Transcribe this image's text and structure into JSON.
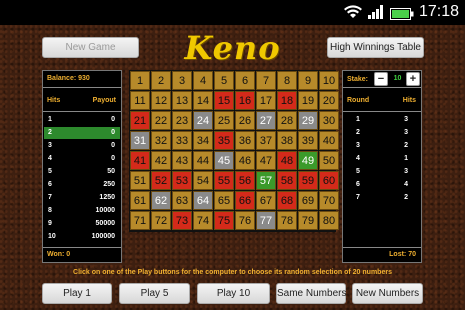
{
  "status_bar": {
    "time": "17:18",
    "icons": [
      "wifi-icon",
      "signal-icon",
      "battery-icon"
    ]
  },
  "app": {
    "title": "Keno",
    "new_game_label": "New Game",
    "high_winnings_label": "High Winnings Table"
  },
  "left_panel": {
    "balance_label": "Balance: 930",
    "hits_header": "Hits",
    "payout_header": "Payout",
    "rows": [
      {
        "hits": "1",
        "payout": "0",
        "highlight": false
      },
      {
        "hits": "2",
        "payout": "0",
        "highlight": true
      },
      {
        "hits": "3",
        "payout": "0",
        "highlight": false
      },
      {
        "hits": "4",
        "payout": "0",
        "highlight": false
      },
      {
        "hits": "5",
        "payout": "50",
        "highlight": false
      },
      {
        "hits": "6",
        "payout": "250",
        "highlight": false
      },
      {
        "hits": "7",
        "payout": "1250",
        "highlight": false
      },
      {
        "hits": "8",
        "payout": "10000",
        "highlight": false
      },
      {
        "hits": "9",
        "payout": "50000",
        "highlight": false
      },
      {
        "hits": "10",
        "payout": "100000",
        "highlight": false
      }
    ],
    "won_label": "Won: 0"
  },
  "right_panel": {
    "stake_label": "Stake:",
    "stake_value": "10",
    "minus_label": "−",
    "plus_label": "+",
    "round_header": "Round",
    "hits_header": "Hits",
    "rows": [
      {
        "round": "1",
        "hits": "3"
      },
      {
        "round": "2",
        "hits": "3"
      },
      {
        "round": "3",
        "hits": "2"
      },
      {
        "round": "4",
        "hits": "1"
      },
      {
        "round": "5",
        "hits": "3"
      },
      {
        "round": "6",
        "hits": "4"
      },
      {
        "round": "7",
        "hits": "2"
      }
    ],
    "lost_label": "Lost: 70"
  },
  "grid": {
    "red": [
      15,
      16,
      18,
      21,
      35,
      41,
      48,
      52,
      53,
      55,
      56,
      58,
      59,
      60,
      66,
      68,
      73,
      75
    ],
    "gray": [
      24,
      27,
      29,
      31,
      45,
      62,
      64,
      77
    ],
    "green": [
      49,
      57
    ]
  },
  "instruction": "Click on one of the Play buttons for the computer to choose its random selection of 20 numbers",
  "buttons": {
    "play1": "Play 1",
    "play5": "Play 5",
    "play10": "Play 10",
    "same_numbers": "Same Numbers",
    "new_numbers": "New Numbers"
  }
}
